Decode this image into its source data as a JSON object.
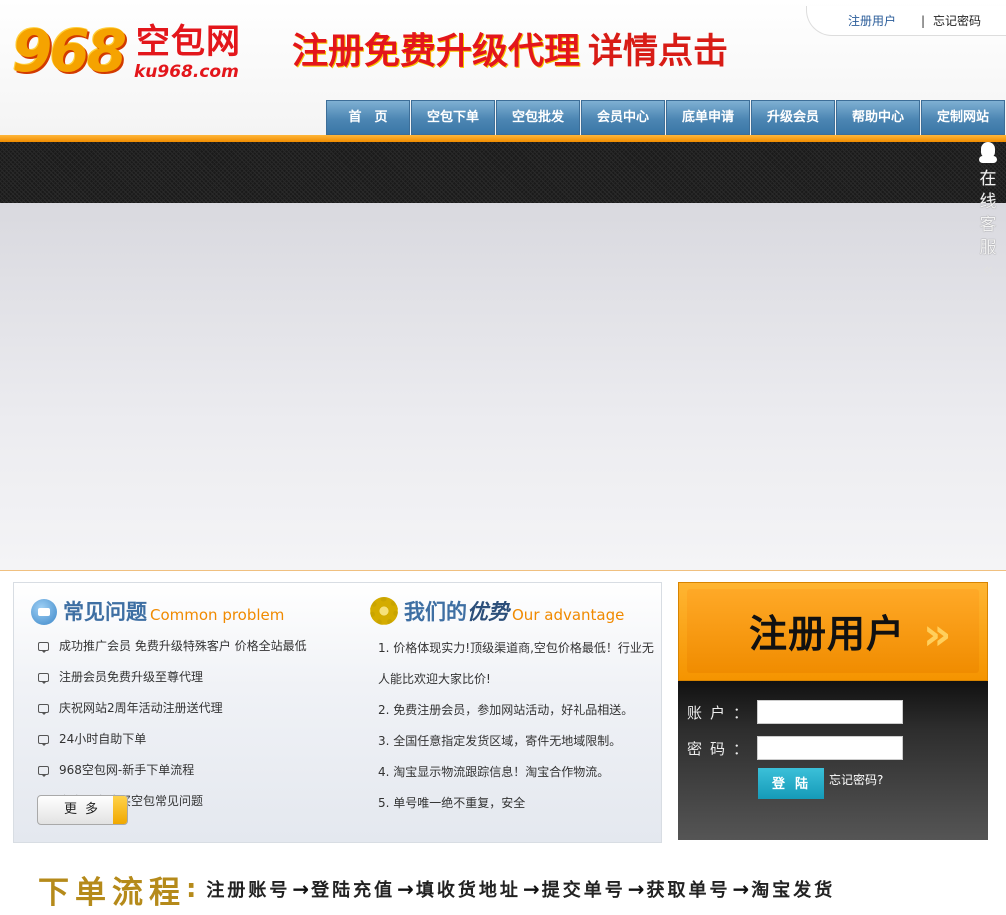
{
  "header": {
    "logo_number": "968",
    "logo_name": "空包网",
    "logo_domain": "ku968.com",
    "promo_main": "注册免费升级代理",
    "promo_link": "详情点击",
    "top_links": {
      "register": "注册用户",
      "separator": "|",
      "forgot": "忘记密码"
    }
  },
  "nav": {
    "items": [
      "首　页",
      "空包下单",
      "空包批发",
      "会员中心",
      "底单申请",
      "升级会员",
      "帮助中心",
      "定制网站"
    ]
  },
  "service": {
    "text": "在线客服",
    "arrow": "«"
  },
  "faq": {
    "title_cn": "常见问题",
    "title_en": "Common problem",
    "items": [
      "成功推广会员 免费升级特殊客户 价格全站最低",
      "注册会员免费升级至尊代理",
      "庆祝网站2周年活动注册送代理",
      "24小时自助下单",
      "968空包网-新手下单流程",
      "淘宝卖家购买空包常见问题"
    ],
    "more_label": "更多"
  },
  "advantage": {
    "title_cn_1": "我们的",
    "title_cn_2": "优势",
    "title_en": "Our advantage",
    "items": [
      "1. 价格体现实力!顶级渠道商,空包价格最低！行业无",
      "人能比欢迎大家比价!",
      "2. 免费注册会员，参加网站活动，好礼品相送。",
      "3. 全国任意指定发货区域，寄件无地域限制。",
      "4. 淘宝显示物流跟踪信息！淘宝合作物流。",
      "5. 单号唯一绝不重复，安全"
    ]
  },
  "register": {
    "title": "注册用户",
    "arrow": "»",
    "account_label": "账户：",
    "password_label": "密码：",
    "account_value": "",
    "password_value": "",
    "login_label": "登陆",
    "forgot_label": "忘记密码?"
  },
  "flow": {
    "title": "下单流程",
    "colon": ":",
    "steps": [
      "注册账号",
      "登陆充值",
      "填收货地址",
      "提交单号",
      "获取单号",
      "淘宝发货"
    ],
    "arrow": "→"
  },
  "colors": {
    "accent": "#f59400",
    "nav": "#4c86b3",
    "brand_red": "#e3161b",
    "button": "#159ab8"
  }
}
